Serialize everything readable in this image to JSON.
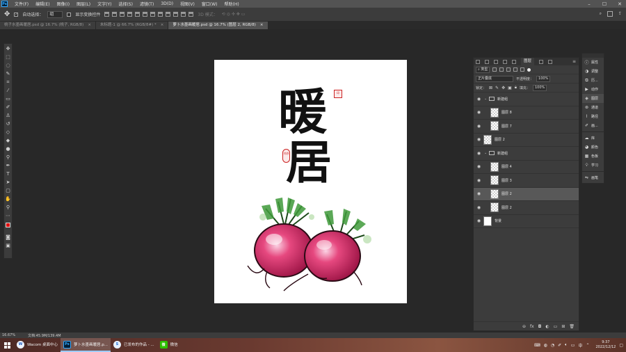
{
  "app": {
    "logo": "Ps",
    "menu": [
      "文件(F)",
      "编辑(E)",
      "图像(I)",
      "图层(L)",
      "文字(Y)",
      "选择(S)",
      "滤镜(T)",
      "3D(D)",
      "视图(V)",
      "窗口(W)",
      "帮助(H)"
    ],
    "window_controls": [
      "minimize-icon",
      "maximize-icon",
      "close-icon"
    ]
  },
  "options": {
    "auto_select_label": "自动选择：",
    "auto_select_value": "组",
    "transform_label": "显示变换控件",
    "mode_3d_label": "3D 模式："
  },
  "tabs": [
    {
      "label": "桃子水墨画暖居.psd @ 16.7% (桃子, RGB/8)",
      "close": "×"
    },
    {
      "label": "未标题-1 @ 66.7% (RGB/8#) *",
      "close": "×"
    },
    {
      "label": "萝卜水墨画暖居.psd @ 16.7% (图层 2, RGB/8)",
      "close": "×",
      "active": true
    }
  ],
  "canvas": {
    "title_line1": "暖",
    "title_line2": "居",
    "seal_top": "印",
    "seal_side": "刘亦"
  },
  "layers_panel": {
    "tab_label": "图层",
    "filter": "类型",
    "blend_mode": "正片叠底",
    "opacity_label": "不透明度：",
    "opacity_value": "100%",
    "lock_label": "锁定：",
    "fill_label": "填充：",
    "fill_value": "100%",
    "items": [
      {
        "name": "新建组",
        "kind": "group"
      },
      {
        "name": "图层 8",
        "kind": "layer"
      },
      {
        "name": "图层 7",
        "kind": "layer"
      },
      {
        "name": "图层 2",
        "kind": "layer-top"
      },
      {
        "name": "新建组",
        "kind": "group"
      },
      {
        "name": "图层 4",
        "kind": "layer"
      },
      {
        "name": "图层 3",
        "kind": "layer"
      },
      {
        "name": "图层 2",
        "kind": "layer",
        "selected": true
      },
      {
        "name": "图层 2",
        "kind": "layer"
      },
      {
        "name": "背景",
        "kind": "background"
      }
    ]
  },
  "dock": [
    {
      "icon": "info-icon",
      "label": "属性"
    },
    {
      "icon": "adjust-icon",
      "label": "调整"
    },
    {
      "icon": "history-icon",
      "label": "历..."
    },
    {
      "icon": "actions-icon",
      "label": "动作"
    },
    {
      "icon": "layers-icon",
      "label": "图层",
      "active": true
    },
    {
      "icon": "channels-icon",
      "label": "通道"
    },
    {
      "icon": "paths-icon",
      "label": "路径"
    },
    {
      "icon": "brush-icon",
      "label": "画..."
    },
    {
      "icon": "library-icon",
      "label": "库"
    },
    {
      "icon": "color-icon",
      "label": "颜色"
    },
    {
      "icon": "swatches-icon",
      "label": "色板"
    },
    {
      "icon": "learn-icon",
      "label": "学习"
    },
    {
      "icon": "brush-settings-icon",
      "label": "画笔"
    }
  ],
  "status": {
    "zoom": "16.67%",
    "doc": "文档:45.9M/139.4M"
  },
  "taskbar": {
    "items": [
      {
        "label": "Wacom 桌面中心",
        "icon": "W"
      },
      {
        "label": "萝卜水墨画暖居.p...",
        "icon": "Ps",
        "active": true
      },
      {
        "label": "已发布的作品 - ...",
        "icon": "S"
      },
      {
        "label": "微信",
        "icon": "微"
      }
    ],
    "time": "9:37",
    "date": "2022/12/12"
  }
}
